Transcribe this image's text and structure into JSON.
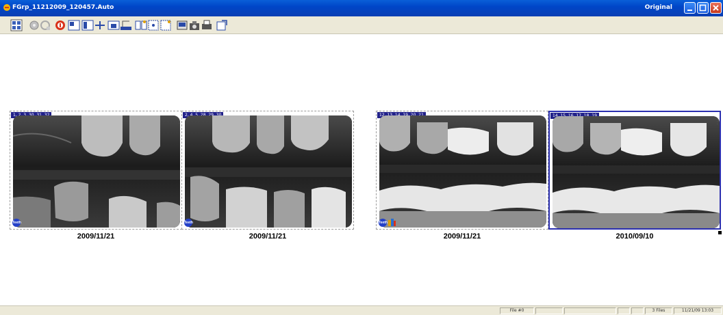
{
  "window": {
    "title": "FGrp_11212009_120457.Auto",
    "mode": "Original",
    "colors": {
      "titlebar": "#0046c8",
      "selection": "#2b2fb0",
      "tooth_label_bg": "#22228a"
    }
  },
  "toolbar": {
    "buttons": [
      {
        "icon": "grid-layout-icon"
      },
      {
        "icon": "image-tools-icon"
      },
      {
        "icon": "settings-wheel-icon"
      },
      {
        "icon": "info-circle-icon"
      },
      {
        "icon": "window-layout-a-icon"
      },
      {
        "icon": "window-layout-b-icon"
      },
      {
        "icon": "measure-icon"
      },
      {
        "icon": "single-view-icon"
      },
      {
        "icon": "scan-icon"
      },
      {
        "icon": "compare-icon"
      },
      {
        "icon": "grid-view-icon"
      },
      {
        "icon": "enhance-icon"
      },
      {
        "icon": "import-icon"
      },
      {
        "icon": "camera-icon"
      },
      {
        "icon": "print-icon"
      },
      {
        "icon": "export-icon"
      }
    ]
  },
  "images": [
    {
      "teeth": "1, 2, 3, 30, 31, 32",
      "date": "2009/11/21",
      "selected": false,
      "badge": "Teeth"
    },
    {
      "teeth": "2, 4, 5, 28, 29, 30",
      "date": "2009/11/21",
      "selected": false,
      "badge": "Teeth"
    },
    {
      "teeth": "12, 13, 14, 19, 20, 21",
      "date": "2009/11/21",
      "selected": false,
      "badge": "Teeth"
    },
    {
      "teeth": "14, 15, 16, 17, 18, 19",
      "date": "2010/09/10",
      "selected": true,
      "badge": ""
    }
  ],
  "statusbar": {
    "file": "File #0",
    "files": "3 Files",
    "datetime": "11/21/09  13:03"
  }
}
